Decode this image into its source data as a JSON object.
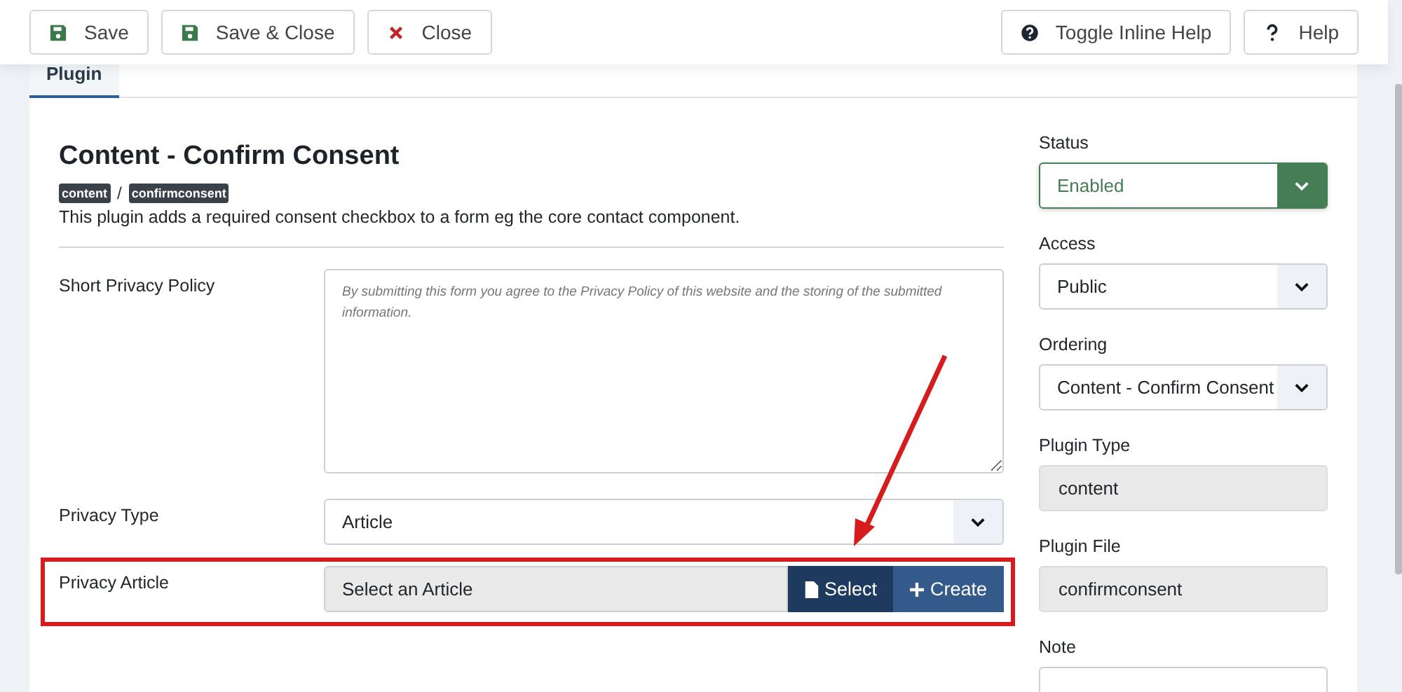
{
  "toolbar": {
    "left": [
      {
        "label": "Save",
        "kind": "save"
      },
      {
        "label": "Save & Close",
        "kind": "save"
      },
      {
        "label": "Close",
        "kind": "close"
      }
    ],
    "right": [
      {
        "label": "Toggle Inline Help",
        "kind": "inline-help"
      },
      {
        "label": "Help",
        "kind": "help"
      }
    ]
  },
  "tabs": [
    {
      "label": "Plugin",
      "selected": true
    }
  ],
  "title": "Content - Confirm Consent",
  "tags": [
    "content",
    "confirmconsent"
  ],
  "tag_separator": "/",
  "description": "This plugin adds a required consent checkbox to a form eg the core contact component.",
  "fields": [
    {
      "kind": "textarea",
      "label": "Short Privacy Policy",
      "placeholder": "By submitting this form you agree to the Privacy Policy of this website and the storing of the submitted information.",
      "highlighted": false
    },
    {
      "kind": "select",
      "label": "Privacy Type",
      "value": "Article",
      "highlighted": false
    },
    {
      "kind": "modal",
      "label": "Privacy Article",
      "value": "Select an Article",
      "buttons": [
        {
          "label": "Select",
          "kind": "select"
        },
        {
          "label": "Create",
          "kind": "create"
        }
      ],
      "highlighted": true
    }
  ],
  "sidebar": [
    {
      "kind": "status",
      "label": "Status",
      "value": "Enabled"
    },
    {
      "kind": "select",
      "label": "Access",
      "value": "Public"
    },
    {
      "kind": "select",
      "label": "Ordering",
      "value": "Content - Confirm Consent"
    },
    {
      "kind": "readonly",
      "label": "Plugin Type",
      "value": "content"
    },
    {
      "kind": "readonly",
      "label": "Plugin File",
      "value": "confirmconsent"
    },
    {
      "kind": "text",
      "label": "Note"
    }
  ]
}
